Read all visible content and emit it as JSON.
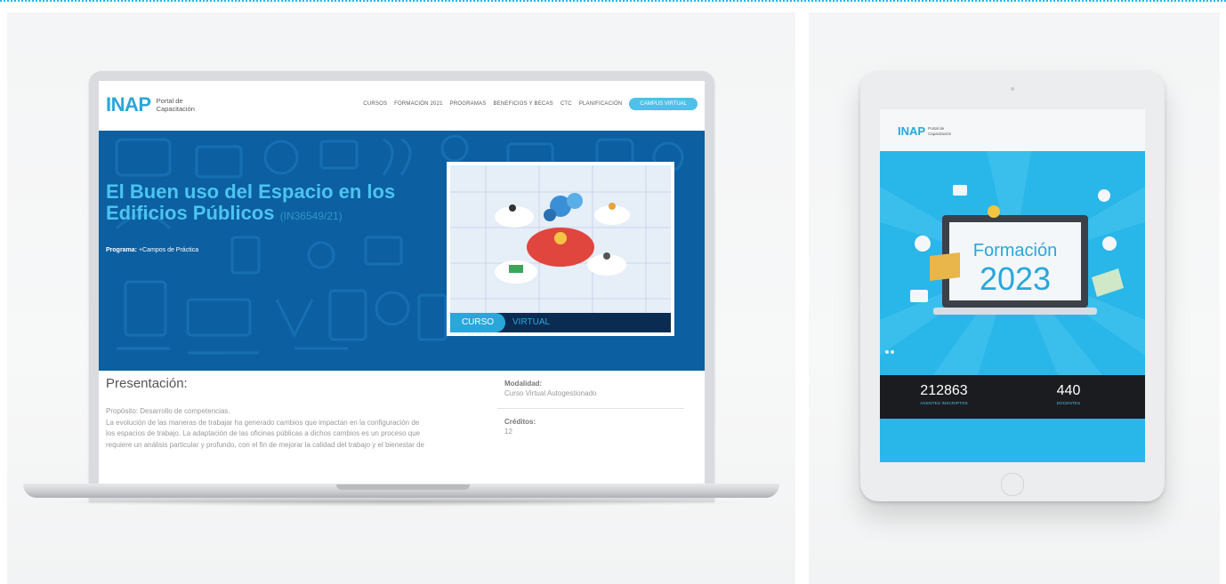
{
  "laptop_site": {
    "logo": {
      "mark": "INAP",
      "sub_line1": "Portal de",
      "sub_line2": "Capacitación"
    },
    "nav": [
      "CURSOS",
      "FORMACIÓN 2021",
      "PROGRAMAS",
      "BENEFICIOS Y BECAS",
      "CTC",
      "PLANIFICACIÓN"
    ],
    "nav_cta": "CAMPUS VIRTUAL",
    "hero": {
      "title_line1": "El Buen uso del Espacio en los",
      "title_line2": "Edificios Públicos",
      "code": "(IN36549/21)",
      "program_label": "Programa:",
      "program_value": "+Campos de Práctica",
      "card_tag_a": "CURSO",
      "card_tag_b": "VIRTUAL"
    },
    "content": {
      "title": "Presentación:",
      "lines": [
        "Propósito: Desarrollo de competencias.",
        "La evolución de las maneras de trabajar ha generado cambios que impactan en la configuración de",
        "los espacios de trabajo. La adaptación de las oficinas públicas a dichos cambios es un proceso que",
        "requiere un análisis particular y profundo, con el fin de mejorar la calidad del trabajo y el bienestar de"
      ],
      "modalidad_label": "Modalidad:",
      "modalidad_value": "Curso Virtual Autogestionado",
      "creditos_label": "Créditos:",
      "creditos_value": "12"
    }
  },
  "tablet_site": {
    "logo": {
      "mark": "INAP",
      "sub_line1": "Portal de",
      "sub_line2": "Capacitación"
    },
    "hero_line1": "Formación",
    "hero_line2": "2023",
    "stats": [
      {
        "number": "212863",
        "label": "AGENTES INSCRIPTOS"
      },
      {
        "number": "440",
        "label": "DOCENTES"
      }
    ]
  },
  "colors": {
    "brand_blue": "#29a7db",
    "hero_blue": "#0c5fa0",
    "light_blue": "#29b6e8",
    "dark_bar": "#1b1c1f"
  }
}
